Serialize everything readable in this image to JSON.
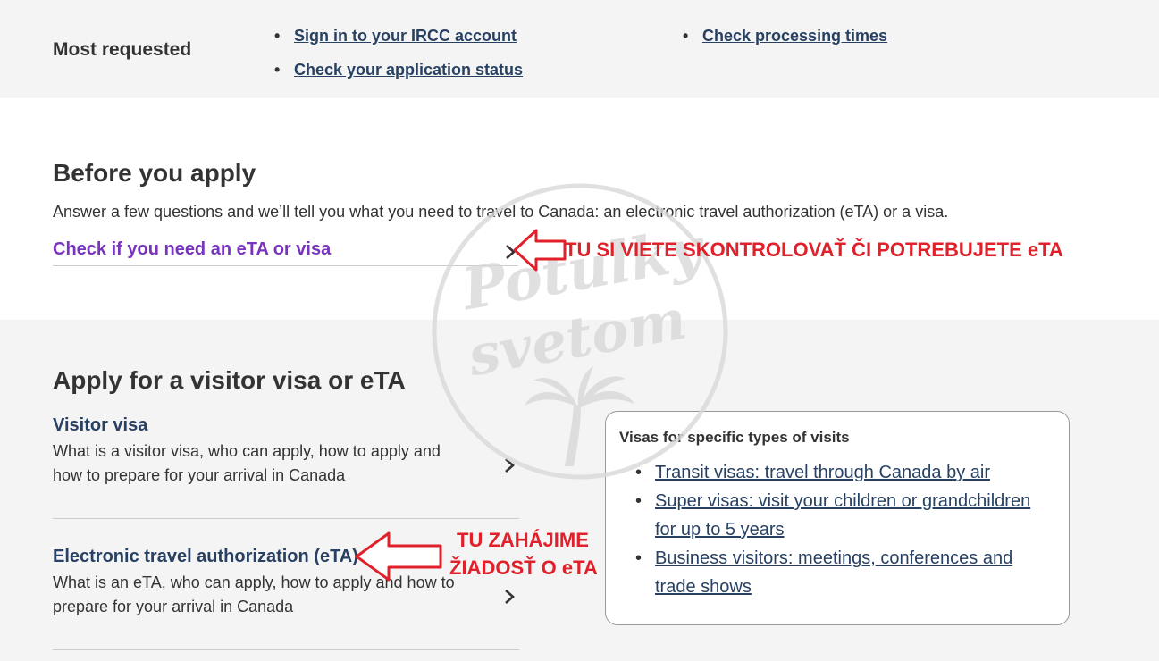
{
  "most_requested": {
    "title": "Most requested",
    "links_col1": [
      "Sign in to your IRCC account",
      "Check your application status"
    ],
    "links_col2": [
      "Check processing times"
    ]
  },
  "before_apply": {
    "title": "Before you apply",
    "description": "Answer a few questions and we’ll tell you what you need to travel to Canada: an electronic travel authorization (eTA) or a visa.",
    "check_link": "Check if you need an eTA or visa"
  },
  "apply_section": {
    "title": "Apply for a visitor visa or eTA",
    "cards": [
      {
        "title": "Visitor visa",
        "description": "What is a visitor visa, who can apply, how to apply and how to prepare for your arrival in Canada"
      },
      {
        "title": "Electronic travel authorization (eTA)",
        "description": "What is an eTA, who can apply, how to apply and how to prepare for your arrival in Canada"
      }
    ],
    "side_box": {
      "title": "Visas for specific types of visits",
      "links": [
        "Transit visas: travel through Canada by air",
        "Super visas: visit your children or grandchildren for up to 5 years",
        "Business visitors: meetings, conferences and trade shows"
      ]
    }
  },
  "annotations": {
    "check_note": "TU SI VIETE SKONTROLOVAŤ ČI POTREBUJETE eTA",
    "eta_note_line1": "TU ZAHÁJIME",
    "eta_note_line2": "ŽIADOSŤ O eTA"
  },
  "watermark": {
    "line1": "Potulky",
    "line2": "svetom"
  },
  "colors": {
    "link": "#284162",
    "visited_link": "#7834bc",
    "annotation": "#e0202a",
    "band": "#f4f4f4"
  }
}
